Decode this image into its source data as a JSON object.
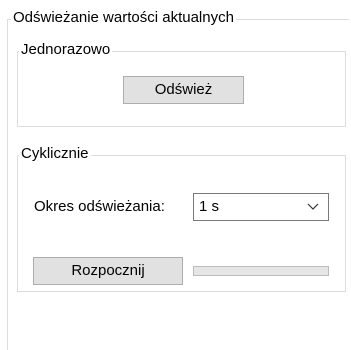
{
  "outer_group": {
    "title": "Odświeżanie wartości aktualnych"
  },
  "single_group": {
    "title": "Jednorazowo",
    "refresh_button_label": "Odśwież"
  },
  "cyclic_group": {
    "title": "Cyklicznie",
    "period_label": "Okres odświeżania:",
    "period_select": {
      "selected": "1 s"
    },
    "start_button_label": "Rozpocznij",
    "progress": {
      "value_percent": 0
    }
  },
  "icons": {
    "dropdown": "chevron-down-icon"
  }
}
